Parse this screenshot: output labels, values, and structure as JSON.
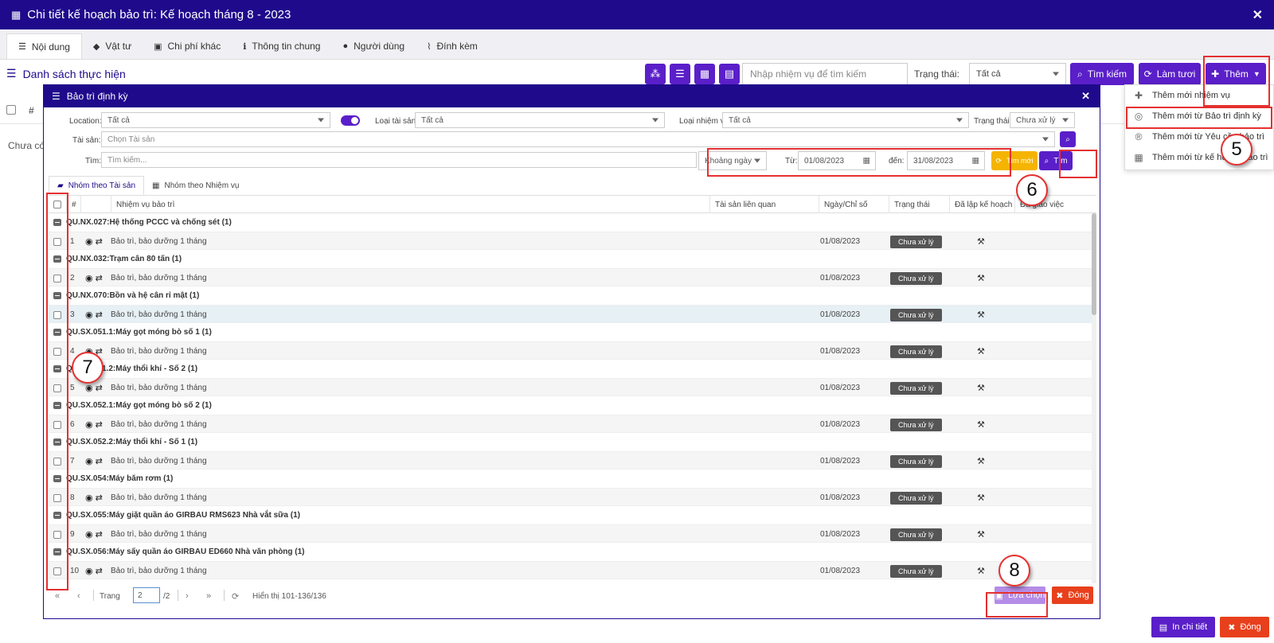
{
  "window": {
    "title": "Chi tiết kế hoạch bảo trì: Kế hoạch tháng 8 - 2023"
  },
  "tabs": [
    {
      "label": "Nội dung",
      "icon": "list-icon"
    },
    {
      "label": "Vật tư",
      "icon": "tag-icon"
    },
    {
      "label": "Chi phí khác",
      "icon": "money-icon"
    },
    {
      "label": "Thông tin chung",
      "icon": "info-icon"
    },
    {
      "label": "Người dùng",
      "icon": "users-icon"
    },
    {
      "label": "Đính kèm",
      "icon": "paperclip-icon"
    }
  ],
  "toolbar": {
    "list_title": "Danh sách thực hiện",
    "search_placeholder": "Nhập nhiệm vụ để tìm kiếm",
    "status_label": "Trạng thái:",
    "status_value": "Tất cả",
    "search_button": "Tìm kiếm",
    "refresh_button": "Làm tươi",
    "add_button": "Thêm"
  },
  "background_table": {
    "hash": "#",
    "empty_text": "Chưa có"
  },
  "add_menu": [
    {
      "label": "Thêm mới nhiệm vụ",
      "icon": "plus-icon"
    },
    {
      "label": "Thêm mới từ Bảo trì định kỳ",
      "icon": "check-circle-icon"
    },
    {
      "label": "Thêm mới từ Yêu cầu bảo trì",
      "icon": "registered-icon"
    },
    {
      "label": "Thêm mới từ kế hoạch bảo trì",
      "icon": "calendar-icon"
    }
  ],
  "modal": {
    "title": "Bảo trì định kỳ",
    "filters": {
      "location_label": "Location:",
      "location_value": "Tất cả",
      "asset_type_label": "Loại tài sản:",
      "asset_type_value": "Tất cả",
      "task_type_label": "Loại nhiệm vụ:",
      "task_type_value": "Tất cả",
      "status_label": "Trạng thái:",
      "status_value": "Chưa xử lý",
      "asset_label": "Tài sản:",
      "asset_placeholder": "Chọn Tài sản",
      "search_label": "Tìm:",
      "search_placeholder": "Tìm kiếm...",
      "date_mode": "Khoảng ngày",
      "from_label": "Từ:",
      "from_value": "01/08/2023",
      "to_label": "đến:",
      "to_value": "31/08/2023",
      "reset_button": "Tìm mới",
      "find_button": "Tìm"
    },
    "subtabs": [
      {
        "label": "Nhóm theo Tài sản",
        "icon": "book-icon"
      },
      {
        "label": "Nhóm theo Nhiệm vụ",
        "icon": "calendar-icon"
      }
    ],
    "columns": [
      "#",
      "Nhiệm vụ bảo trì",
      "Tài sản liên quan",
      "Ngày/Chỉ số",
      "Trạng thái",
      "Đã lập kế hoạch",
      "Đã giao việc"
    ],
    "groups": [
      {
        "title": "QU.NX.027:Hệ thống PCCC và chống sét (1)",
        "num": "1",
        "task": "Bảo trì, bảo dưỡng 1 tháng",
        "date": "01/08/2023",
        "status": "Chưa xử lý"
      },
      {
        "title": "QU.NX.032:Trạm cân 80 tấn (1)",
        "num": "2",
        "task": "Bảo trì, bảo dưỡng 1 tháng",
        "date": "01/08/2023",
        "status": "Chưa xử lý"
      },
      {
        "title": "QU.NX.070:Bồn và hệ cân rỉ mật (1)",
        "num": "3",
        "task": "Bảo trì, bảo dưỡng 1 tháng",
        "date": "01/08/2023",
        "status": "Chưa xử lý"
      },
      {
        "title": "QU.SX.051.1:Máy gọt móng bò số 1 (1)",
        "num": "4",
        "task": "Bảo trì, bảo dưỡng 1 tháng",
        "date": "01/08/2023",
        "status": "Chưa xử lý"
      },
      {
        "title": "QU.SX.051.2:Máy thổi khí - Số 2 (1)",
        "num": "5",
        "task": "Bảo trì, bảo dưỡng 1 tháng",
        "date": "01/08/2023",
        "status": "Chưa xử lý"
      },
      {
        "title": "QU.SX.052.1:Máy gọt móng bò số 2 (1)",
        "num": "6",
        "task": "Bảo trì, bảo dưỡng 1 tháng",
        "date": "01/08/2023",
        "status": "Chưa xử lý"
      },
      {
        "title": "QU.SX.052.2:Máy thổi khí - Số 1 (1)",
        "num": "7",
        "task": "Bảo trì, bảo dưỡng 1 tháng",
        "date": "01/08/2023",
        "status": "Chưa xử lý"
      },
      {
        "title": "QU.SX.054:Máy băm rơm (1)",
        "num": "8",
        "task": "Bảo trì, bảo dưỡng 1 tháng",
        "date": "01/08/2023",
        "status": "Chưa xử lý"
      },
      {
        "title": "QU.SX.055:Máy giặt quần áo GIRBAU RMS623 Nhà vắt sữa (1)",
        "num": "9",
        "task": "Bảo trì, bảo dưỡng 1 tháng",
        "date": "01/08/2023",
        "status": "Chưa xử lý"
      },
      {
        "title": "QU.SX.056:Máy sấy quần áo GIRBAU ED660 Nhà văn phòng (1)",
        "num": "10",
        "task": "Bảo trì, bảo dưỡng 1 tháng",
        "date": "01/08/2023",
        "status": "Chưa xử lý"
      }
    ],
    "pager": {
      "page_label": "Trang",
      "page_value": "2",
      "total_pages": "/2",
      "display_text": "Hiển thị 101-136/136"
    },
    "select_button": "Lựa chọn",
    "close_button": "Đóng"
  },
  "footer": {
    "print_button": "In chi tiết",
    "close_button": "Đóng"
  },
  "callouts": [
    "5",
    "6",
    "7",
    "8"
  ],
  "colors": {
    "header": "#1f0a8c",
    "primary": "#5a1fc9",
    "danger": "#e8401c",
    "warning": "#f4b400",
    "annotation": "#e53030"
  }
}
